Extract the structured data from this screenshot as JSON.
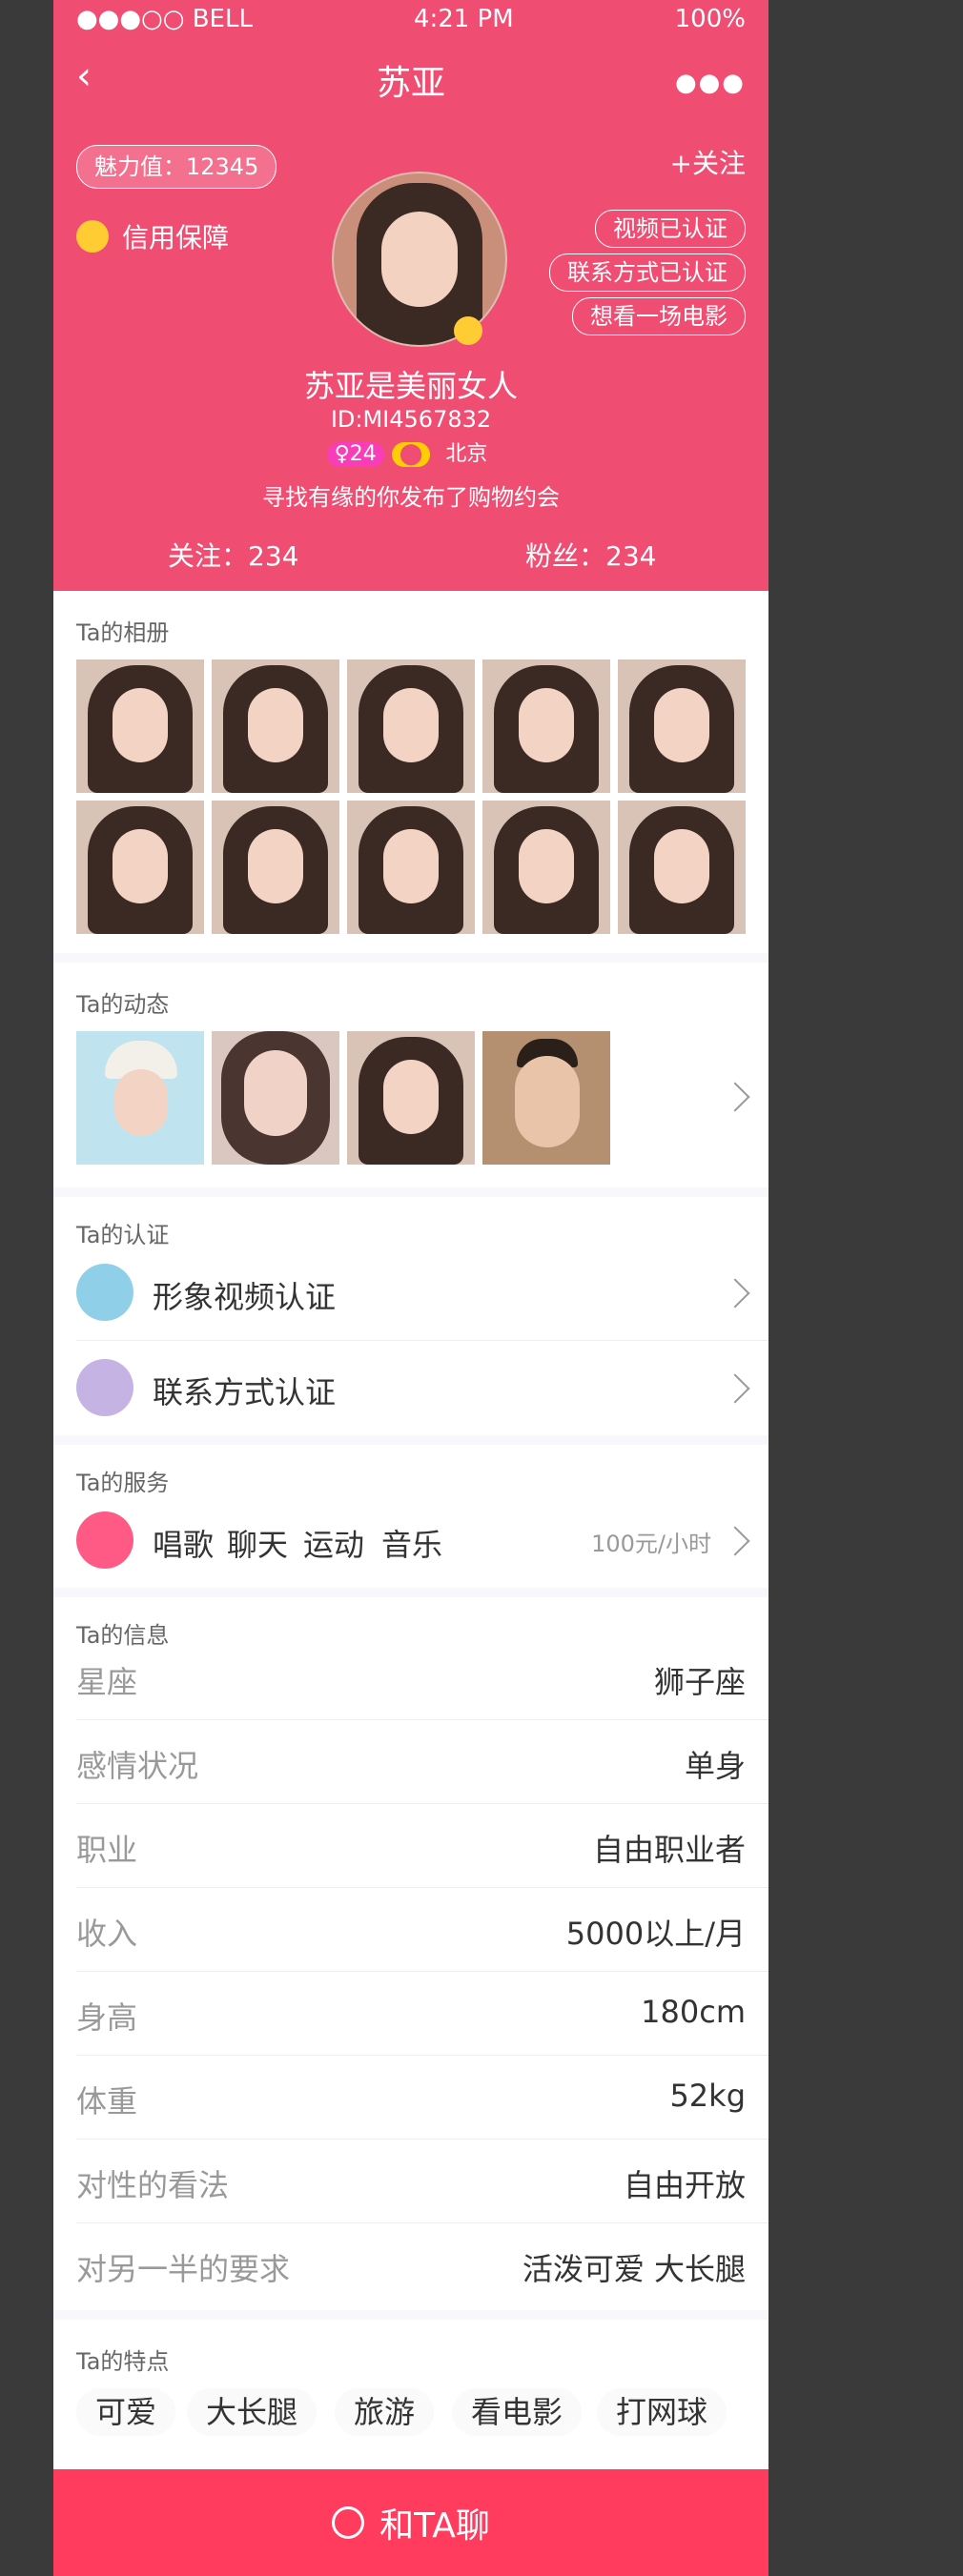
{
  "status": {
    "carrier": "●●●○○ BELL",
    "time": "4:21 PM",
    "battery": "100%"
  },
  "header": {
    "title": "苏亚",
    "more": "●●●",
    "follow": "+关注"
  },
  "profile": {
    "charm": "魅力值：12345",
    "credit": "信用保障",
    "verify_tags": [
      "视频已认证",
      "联系方式已认证",
      "想看一场电影"
    ],
    "name": "苏亚是美丽女人",
    "uid": "ID:MI4567832",
    "age": "♀24",
    "level": "⬤",
    "city": "北京",
    "motto": "寻找有缘的你发布了购物约会",
    "follows": "关注：234",
    "fans": "粉丝：234",
    "colors": {
      "bg": "#f04d72",
      "female": "#f93cb8",
      "level": "#ffcd05"
    }
  },
  "album": {
    "title": "Ta的相册"
  },
  "dynamic": {
    "title": "Ta的动态"
  },
  "cert": {
    "title": "Ta的认证",
    "items": [
      "形象视频认证",
      "联系方式认证"
    ]
  },
  "service": {
    "title": "Ta的服务",
    "items": [
      "唱歌",
      "聊天",
      "运动",
      "音乐"
    ],
    "price": "100元/小时"
  },
  "info": {
    "title": "Ta的信息",
    "rows": [
      {
        "label": "星座",
        "value": "狮子座"
      },
      {
        "label": "感情状况",
        "value": "单身"
      },
      {
        "label": "职业",
        "value": "自由职业者"
      },
      {
        "label": "收入",
        "value": "5000以上/月"
      },
      {
        "label": "身高",
        "value": "180cm"
      },
      {
        "label": "体重",
        "value": "52kg"
      },
      {
        "label": "对性的看法",
        "value": "自由开放"
      },
      {
        "label": "对另一半的要求",
        "value": "活泼可爱 大长腿"
      }
    ]
  },
  "traits": {
    "title": "Ta的特点",
    "items": [
      "可爱",
      "大长腿",
      "旅游",
      "看电影",
      "打网球"
    ]
  },
  "bottom": {
    "label": "和TA聊",
    "color": "#ff3b5e"
  }
}
